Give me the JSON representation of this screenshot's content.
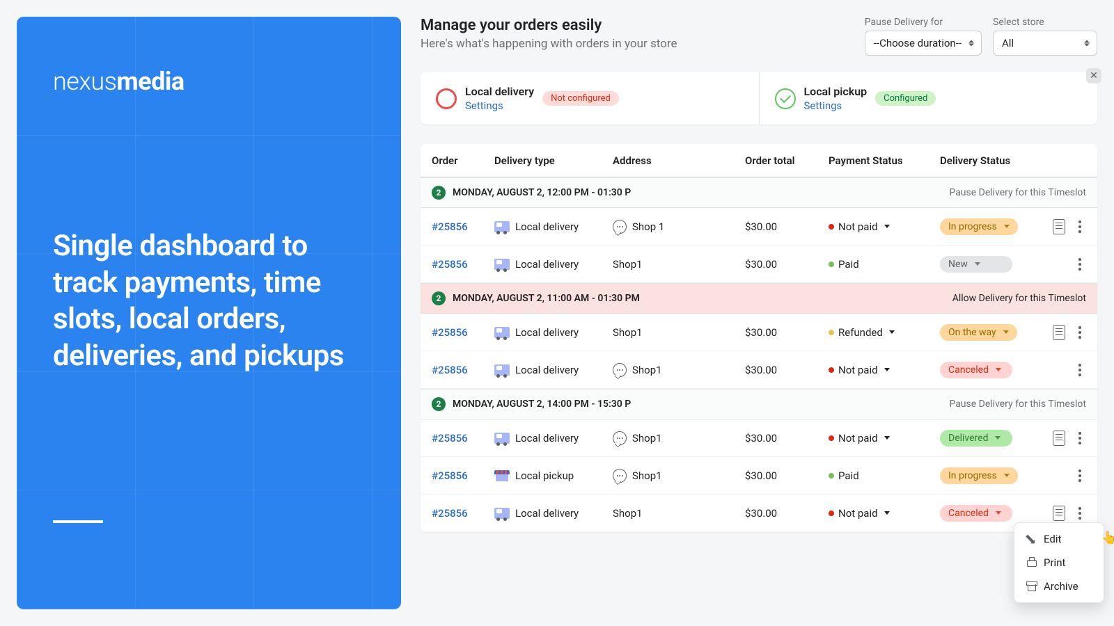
{
  "promo": {
    "logo_thin": "nexus",
    "logo_bold": "media",
    "headline": "Single dashboard to track payments, time slots, local orders, deliveries, and pickups"
  },
  "header": {
    "title": "Manage your orders easily",
    "subtitle": "Here's what's happening with orders in your store",
    "pause_label": "Pause Delivery for",
    "pause_value": "--Choose duration--",
    "store_label": "Select store",
    "store_value": "All"
  },
  "config": {
    "delivery_name": "Local delivery",
    "delivery_link": "Settings",
    "delivery_badge": "Not configured",
    "pickup_name": "Local pickup",
    "pickup_link": "Settings",
    "pickup_badge": "Configured"
  },
  "columns": {
    "order": "Order",
    "dtype": "Delivery type",
    "address": "Address",
    "total": "Order total",
    "payment": "Payment Status",
    "delivery": "Delivery Status"
  },
  "groups": [
    {
      "count": "2",
      "label": "MONDAY, AUGUST 2, 12:00 PM - 01:30 P",
      "paused": false,
      "action": "Pause Delivery for this Timeslot"
    },
    {
      "count": "2",
      "label": "MONDAY, AUGUST 2, 11:00 AM - 01:30 PM",
      "paused": true,
      "action": "Allow Delivery for this Timeslot"
    },
    {
      "count": "2",
      "label": "MONDAY, AUGUST 2, 14:00 PM - 15:30 P",
      "paused": false,
      "action": "Pause Delivery for this Timeslot"
    }
  ],
  "rows": [
    {
      "group": 0,
      "order": "#25856",
      "dtype": "Local delivery",
      "dicon": "truck",
      "bubble": true,
      "address": "Shop 1",
      "total": "$30.00",
      "pay_dot": "r",
      "pay": "Not paid",
      "pay_caret": true,
      "status": "In progress",
      "status_cls": "orange",
      "doc": true
    },
    {
      "group": 0,
      "order": "#25856",
      "dtype": "Local delivery",
      "dicon": "truck",
      "bubble": false,
      "address": "Shop1",
      "total": "$30.00",
      "pay_dot": "g",
      "pay": "Paid",
      "pay_caret": false,
      "status": "New",
      "status_cls": "grey",
      "doc": false
    },
    {
      "group": 1,
      "order": "#25856",
      "dtype": "Local delivery",
      "dicon": "truck",
      "bubble": false,
      "address": "Shop1",
      "total": "$30.00",
      "pay_dot": "y",
      "pay": "Refunded",
      "pay_caret": true,
      "status": "On the way",
      "status_cls": "orange",
      "doc": true
    },
    {
      "group": 1,
      "order": "#25856",
      "dtype": "Local delivery",
      "dicon": "truck",
      "bubble": true,
      "address": "Shop1",
      "total": "$30.00",
      "pay_dot": "r",
      "pay": "Not paid",
      "pay_caret": true,
      "status": "Canceled",
      "status_cls": "redc",
      "doc": false
    },
    {
      "group": 2,
      "order": "#25856",
      "dtype": "Local delivery",
      "dicon": "truck",
      "bubble": true,
      "address": "Shop1",
      "total": "$30.00",
      "pay_dot": "r",
      "pay": "Not paid",
      "pay_caret": true,
      "status": "Delivered",
      "status_cls": "lime",
      "doc": true
    },
    {
      "group": 2,
      "order": "#25856",
      "dtype": "Local pickup",
      "dicon": "shop",
      "bubble": true,
      "address": "Shop1",
      "total": "$30.00",
      "pay_dot": "g",
      "pay": "Paid",
      "pay_caret": false,
      "status": "In progress",
      "status_cls": "orange",
      "doc": false
    },
    {
      "group": 2,
      "order": "#25856",
      "dtype": "Local delivery",
      "dicon": "truck",
      "bubble": false,
      "address": "Shop1",
      "total": "$30.00",
      "pay_dot": "r",
      "pay": "Not paid",
      "pay_caret": true,
      "status": "Canceled",
      "status_cls": "redc",
      "doc": true,
      "menu": true
    }
  ],
  "menu": {
    "edit": "Edit",
    "print": "Print",
    "archive": "Archive"
  }
}
